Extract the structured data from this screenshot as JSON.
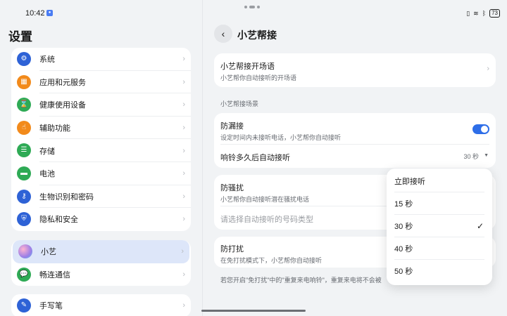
{
  "status_bar": {
    "time": "10:42",
    "battery": "73"
  },
  "settings": {
    "title": "设置",
    "groups": [
      [
        {
          "label": "系统",
          "icon": "gear-icon",
          "color": "#2e62d6"
        },
        {
          "label": "应用和元服务",
          "icon": "apps-grid-icon",
          "color": "#f28a1b"
        },
        {
          "label": "健康使用设备",
          "icon": "hourglass-icon",
          "color": "#2eaa55"
        },
        {
          "label": "辅助功能",
          "icon": "hand-icon",
          "color": "#f28a1b"
        },
        {
          "label": "存储",
          "icon": "storage-icon",
          "color": "#2eaa55"
        },
        {
          "label": "电池",
          "icon": "battery-icon",
          "color": "#2eaa55"
        },
        {
          "label": "生物识别和密码",
          "icon": "key-icon",
          "color": "#2e62d6"
        },
        {
          "label": "隐私和安全",
          "icon": "shield-icon",
          "color": "#2e62d6"
        }
      ],
      [
        {
          "label": "小艺",
          "icon": "xiaoyi-icon",
          "color": "#9b7ee6"
        },
        {
          "label": "畅连通信",
          "icon": "chat-icon",
          "color": "#2eaa55"
        }
      ],
      [
        {
          "label": "手写笔",
          "icon": "pen-icon",
          "color": "#2e62d6"
        }
      ]
    ]
  },
  "page": {
    "title": "小艺帮接",
    "greeting": {
      "title": "小艺帮接开场语",
      "subtitle": "小艺帮你自动接听的开场语"
    },
    "section_label": "小艺帮接场景",
    "missed_call": {
      "title": "防漏接",
      "subtitle": "设定时间内未接听电话，小艺帮你自动接听",
      "enabled": true
    },
    "ring_delay": {
      "title": "响铃多久后自动接听",
      "value": "30 秒"
    },
    "harassment": {
      "title": "防骚扰",
      "subtitle": "小艺帮你自动接听潜在骚扰电话",
      "placeholder": "请选择自动接听的号码类型"
    },
    "dnd": {
      "title": "防打扰",
      "subtitle": "在免打扰模式下，小艺帮你自动接听"
    },
    "footnote": "若您开启\"免打扰\"中的\"重复来电响铃\"，重复来电将不会被"
  },
  "dropdown": {
    "options": [
      "立即接听",
      "15 秒",
      "30 秒",
      "40 秒",
      "50 秒"
    ],
    "selected": "30 秒"
  },
  "accent_color": "#2e6ee8"
}
